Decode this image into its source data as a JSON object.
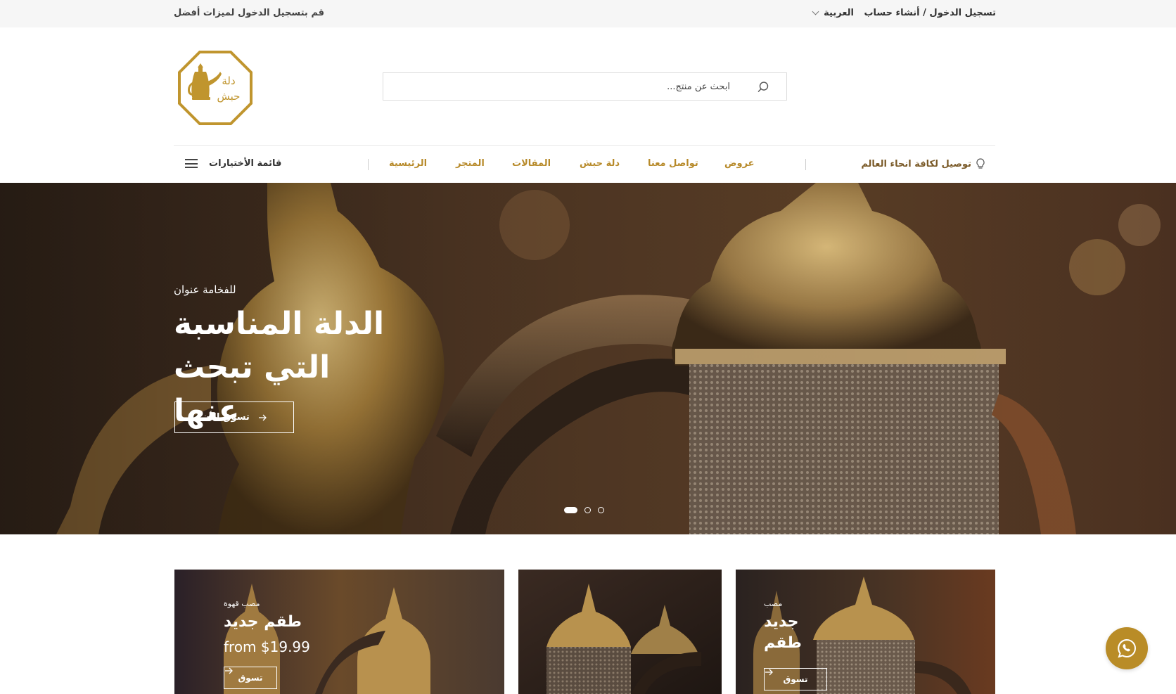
{
  "topbar": {
    "login_link": "تسجيل الدخول / أنشاء حساب",
    "language": "العربية",
    "promo": "قم بتسجيل الدخول لميزات أفضل"
  },
  "header": {
    "logo_text": "دلة حبش",
    "logo_line1": "دلة",
    "logo_line2": "حبش",
    "search_placeholder": "ابحث عن منتج..."
  },
  "nav": {
    "shipping": "توصيل لكافة انحاء العالم",
    "items": [
      "عروض",
      "تواصل معنا",
      "دلة حبش",
      "المقالات",
      "المتجر",
      "الرئيسية"
    ],
    "menu_label": "قائمة الأختيارات"
  },
  "hero": {
    "subtitle": "للفخامة عنوان",
    "headline_line1": "الدلة المناسبة",
    "headline_line2": "التي تبحث عنها",
    "cta": "تسوق الأن",
    "slides": 3,
    "active_slide": 1
  },
  "banners": [
    {
      "subtitle": "مصب قهوة",
      "title": "طقم جديد",
      "price": "from $19.99",
      "button": "تسوق"
    },
    {
      "subtitle": "",
      "title": "",
      "price": "",
      "button": ""
    },
    {
      "subtitle": "مصب",
      "title_line1": "جديد",
      "title_line2": "طقم",
      "button": "تسوق"
    }
  ],
  "colors": {
    "accent": "#b98c27",
    "nav_link": "#b78a2a",
    "topbar_bg": "#f6f6f6"
  }
}
